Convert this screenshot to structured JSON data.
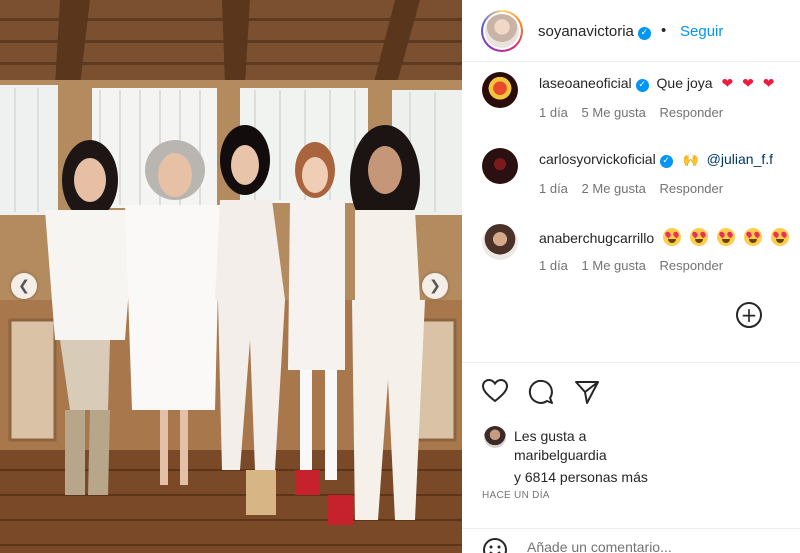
{
  "photo": {
    "description_icon": "photo-carousel",
    "prev_glyph": "❮",
    "next_glyph": "❯"
  },
  "header": {
    "username": "soyanavictoria",
    "verified_glyph": "✓",
    "dot": "•",
    "follow_label": "Seguir"
  },
  "comments": [
    {
      "username": "laseoaneoficial",
      "verified": true,
      "text": "Que joya",
      "emoji": [
        "❤",
        "❤",
        "❤"
      ],
      "time": "1 día",
      "likes": "5 Me gusta",
      "reply": "Responder"
    },
    {
      "username": "carlosyorvickoficial",
      "verified": true,
      "mention": "@julian_f.f",
      "time": "1 día",
      "likes": "2 Me gusta",
      "reply": "Responder"
    },
    {
      "username": "anaberchugcarrillo",
      "verified": false,
      "time": "1 día",
      "likes": "1 Me gusta",
      "reply": "Responder"
    }
  ],
  "add_glyph": "+",
  "actions": {
    "like_icon": "heart-outline-icon",
    "comment_icon": "comment-bubble-icon",
    "share_icon": "paper-plane-icon"
  },
  "likes": {
    "line1": "Les gusta a",
    "user": "maribelguardia",
    "line3": "y 6814 personas más"
  },
  "post_date": "HACE UN DÍA",
  "comment_box": {
    "placeholder": "Añade un comentario..."
  },
  "colors": {
    "accent": "#0095f6",
    "heart": "#ed1c3c",
    "muted": "#737373",
    "text": "#262626"
  }
}
